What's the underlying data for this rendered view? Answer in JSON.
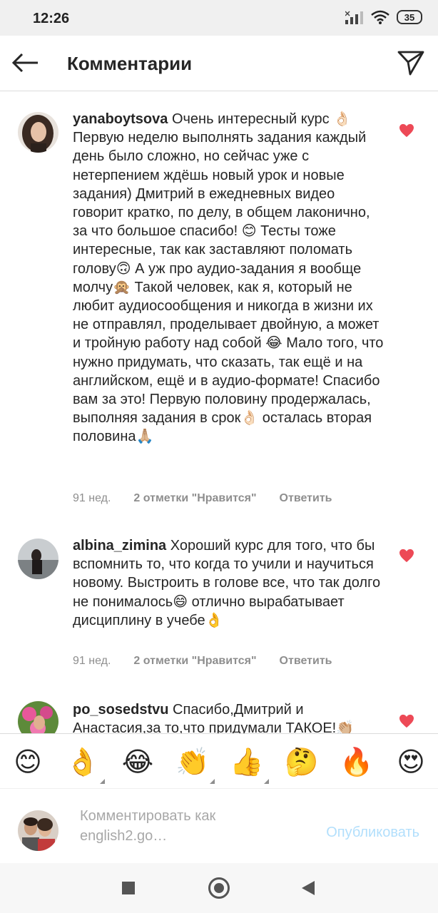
{
  "status_bar": {
    "time": "12:26",
    "battery": "35",
    "icons": [
      "signal-icon",
      "wifi-icon",
      "battery-icon"
    ]
  },
  "header": {
    "title": "Комментарии",
    "back_icon": "arrow-left-icon",
    "share_icon": "direct-send-icon"
  },
  "comments": [
    {
      "username": "yanaboytsova",
      "text": "Очень интересный курс 👌🏻 Первую неделю выполнять задания каждый день было сложно, но сейчас уже с нетерпением ждёшь новый урок и новые задания) Дмитрий в ежедневных видео говорит кратко, по делу, в общем лаконично, за что большое спасибо! 😊 Тесты тоже интересные, так как заставляют поломать голову🙃 А уж про аудио-задания я вообще молчу🙊 Такой человек, как я, который не любит аудиосообщения и никогда в жизни их не отправлял, проделывает двойную, а может и тройную работу над собой 😂 Мало того, что нужно придумать, что сказать, так ещё и на английском, ещё и в аудио-формате! Спасибо вам за это! Первую половину продержалась, выполняя задания в срок👌🏻 осталась вторая половина🙏🏼",
      "time": "91 нед.",
      "likes": "2 отметки \"Нравится\"",
      "reply": "Ответить",
      "liked": true
    },
    {
      "username": "albina_zimina",
      "text": "Хороший курс для того, что бы вспомнить то, что когда то учили  и научиться новому. Выстроить в голове все, что так долго не понималось😄 отлично вырабатывает дисциплину в учебе👌",
      "time": "91 нед.",
      "likes": "2 отметки \"Нравится\"",
      "reply": "Ответить",
      "liked": true
    },
    {
      "username": "po_sosedstvu",
      "text": "Спасибо,Дмитрий и Анастасия,за то,что придумали ТАКОЕ!👏🏼",
      "liked": true
    }
  ],
  "emoji_bar": [
    {
      "emoji": "😊",
      "name": "smiling-face-icon",
      "has_variants": false
    },
    {
      "emoji": "👌",
      "name": "ok-hand-icon",
      "has_variants": true
    },
    {
      "emoji": "😂",
      "name": "tears-of-joy-icon",
      "has_variants": false
    },
    {
      "emoji": "👏",
      "name": "clapping-hands-icon",
      "has_variants": true
    },
    {
      "emoji": "👍",
      "name": "thumbs-up-icon",
      "has_variants": true
    },
    {
      "emoji": "🤔",
      "name": "thinking-face-icon",
      "has_variants": false
    },
    {
      "emoji": "🔥",
      "name": "fire-icon",
      "has_variants": false
    },
    {
      "emoji": "😍",
      "name": "heart-eyes-icon",
      "has_variants": false
    }
  ],
  "composer": {
    "placeholder": "Комментировать как english2.go…",
    "publish": "Опубликовать"
  },
  "colors": {
    "heart": "#ed4956",
    "muted": "#8e8e8e",
    "publish_disabled": "#b2dffc"
  }
}
